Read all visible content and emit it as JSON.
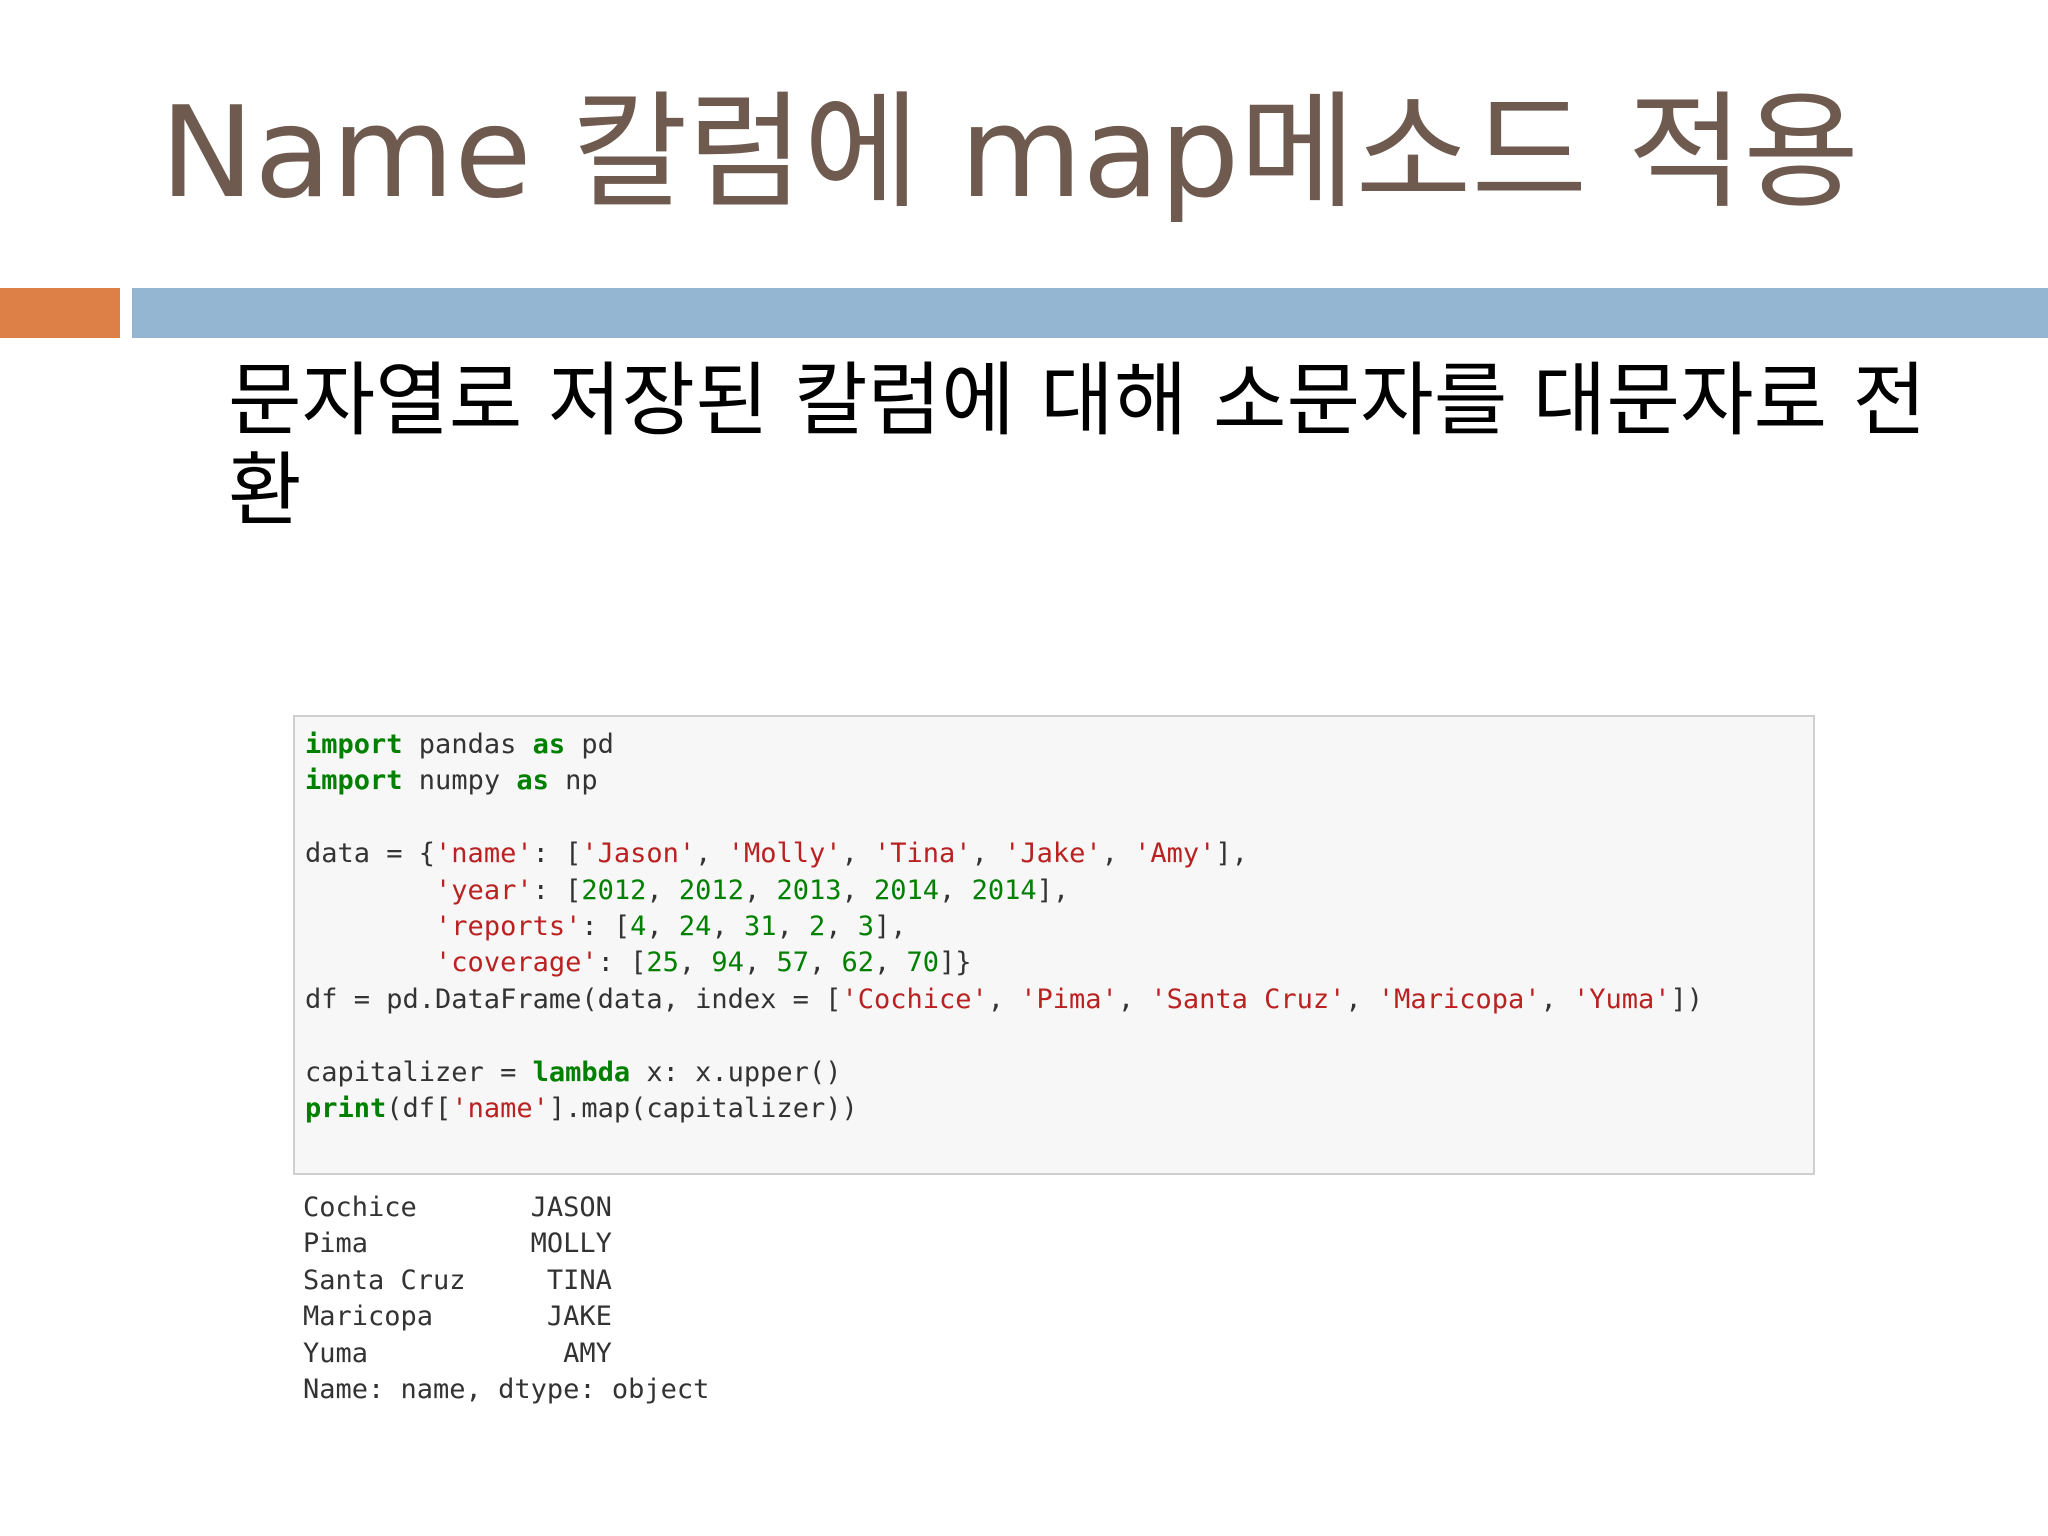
{
  "slide": {
    "title": "Name 칼럼에 map메소드 적용",
    "bullet": "문자열로 저장된 칼럼에 대해 소문자를 대문자로 전환"
  },
  "code": {
    "lines": [
      [
        {
          "t": "import",
          "c": "kw"
        },
        {
          "t": " pandas ",
          "c": ""
        },
        {
          "t": "as",
          "c": "kw"
        },
        {
          "t": " pd",
          "c": ""
        }
      ],
      [
        {
          "t": "import",
          "c": "kw"
        },
        {
          "t": " numpy ",
          "c": ""
        },
        {
          "t": "as",
          "c": "kw"
        },
        {
          "t": " np",
          "c": ""
        }
      ],
      [],
      [
        {
          "t": "data = {",
          "c": ""
        },
        {
          "t": "'name'",
          "c": "st"
        },
        {
          "t": ": [",
          "c": ""
        },
        {
          "t": "'Jason'",
          "c": "st"
        },
        {
          "t": ", ",
          "c": ""
        },
        {
          "t": "'Molly'",
          "c": "st"
        },
        {
          "t": ", ",
          "c": ""
        },
        {
          "t": "'Tina'",
          "c": "st"
        },
        {
          "t": ", ",
          "c": ""
        },
        {
          "t": "'Jake'",
          "c": "st"
        },
        {
          "t": ", ",
          "c": ""
        },
        {
          "t": "'Amy'",
          "c": "st"
        },
        {
          "t": "],",
          "c": ""
        }
      ],
      [
        {
          "t": "        ",
          "c": ""
        },
        {
          "t": "'year'",
          "c": "st"
        },
        {
          "t": ": [",
          "c": ""
        },
        {
          "t": "2012",
          "c": "nm"
        },
        {
          "t": ", ",
          "c": ""
        },
        {
          "t": "2012",
          "c": "nm"
        },
        {
          "t": ", ",
          "c": ""
        },
        {
          "t": "2013",
          "c": "nm"
        },
        {
          "t": ", ",
          "c": ""
        },
        {
          "t": "2014",
          "c": "nm"
        },
        {
          "t": ", ",
          "c": ""
        },
        {
          "t": "2014",
          "c": "nm"
        },
        {
          "t": "],",
          "c": ""
        }
      ],
      [
        {
          "t": "        ",
          "c": ""
        },
        {
          "t": "'reports'",
          "c": "st"
        },
        {
          "t": ": [",
          "c": ""
        },
        {
          "t": "4",
          "c": "nm"
        },
        {
          "t": ", ",
          "c": ""
        },
        {
          "t": "24",
          "c": "nm"
        },
        {
          "t": ", ",
          "c": ""
        },
        {
          "t": "31",
          "c": "nm"
        },
        {
          "t": ", ",
          "c": ""
        },
        {
          "t": "2",
          "c": "nm"
        },
        {
          "t": ", ",
          "c": ""
        },
        {
          "t": "3",
          "c": "nm"
        },
        {
          "t": "],",
          "c": ""
        }
      ],
      [
        {
          "t": "        ",
          "c": ""
        },
        {
          "t": "'coverage'",
          "c": "st"
        },
        {
          "t": ": [",
          "c": ""
        },
        {
          "t": "25",
          "c": "nm"
        },
        {
          "t": ", ",
          "c": ""
        },
        {
          "t": "94",
          "c": "nm"
        },
        {
          "t": ", ",
          "c": ""
        },
        {
          "t": "57",
          "c": "nm"
        },
        {
          "t": ", ",
          "c": ""
        },
        {
          "t": "62",
          "c": "nm"
        },
        {
          "t": ", ",
          "c": ""
        },
        {
          "t": "70",
          "c": "nm"
        },
        {
          "t": "]}",
          "c": ""
        }
      ],
      [
        {
          "t": "df = pd.DataFrame(data, index = [",
          "c": ""
        },
        {
          "t": "'Cochice'",
          "c": "st"
        },
        {
          "t": ", ",
          "c": ""
        },
        {
          "t": "'Pima'",
          "c": "st"
        },
        {
          "t": ", ",
          "c": ""
        },
        {
          "t": "'Santa Cruz'",
          "c": "st"
        },
        {
          "t": ", ",
          "c": ""
        },
        {
          "t": "'Maricopa'",
          "c": "st"
        },
        {
          "t": ", ",
          "c": ""
        },
        {
          "t": "'Yuma'",
          "c": "st"
        },
        {
          "t": "])",
          "c": ""
        }
      ],
      [],
      [
        {
          "t": "capitalizer = ",
          "c": ""
        },
        {
          "t": "lambda",
          "c": "kw"
        },
        {
          "t": " x: x.upper()",
          "c": ""
        }
      ],
      [
        {
          "t": "print",
          "c": "kw"
        },
        {
          "t": "(df[",
          "c": ""
        },
        {
          "t": "'name'",
          "c": "st"
        },
        {
          "t": "].map(capitalizer))",
          "c": ""
        }
      ]
    ]
  },
  "output": {
    "lines": [
      "Cochice       JASON",
      "Pima          MOLLY",
      "Santa Cruz     TINA",
      "Maricopa       JAKE",
      "Yuma            AMY",
      "Name: name, dtype: object"
    ]
  },
  "colors": {
    "title": "#6e5a4f",
    "accent_orange": "#dd8047",
    "accent_blue": "#94b6d2",
    "code_keyword": "#008000",
    "code_string": "#ba2121"
  }
}
